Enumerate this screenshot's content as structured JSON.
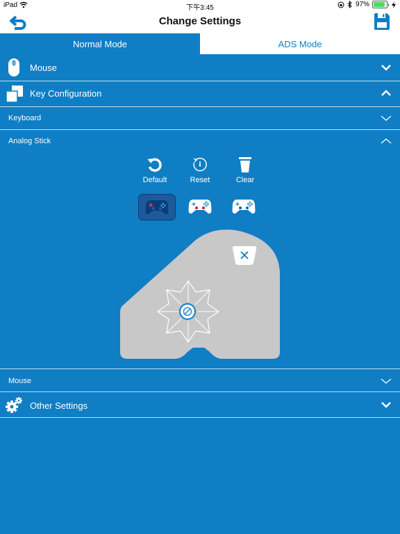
{
  "status": {
    "device": "iPad",
    "time": "下午3:45",
    "battery": "97%",
    "battery_level": 0.97
  },
  "nav": {
    "title": "Change Settings"
  },
  "tabs": [
    {
      "label": "Normal Mode",
      "active": true
    },
    {
      "label": "ADS Mode",
      "active": false
    }
  ],
  "sections": {
    "mouse": {
      "label": "Mouse",
      "icon": "mouse-icon",
      "expanded": false
    },
    "key_config": {
      "label": "Key Configuration",
      "icon": "copy-icon",
      "expanded": true
    },
    "keyboard": {
      "label": "Keyboard",
      "expanded": false
    },
    "analog_stick": {
      "label": "Analog Stick",
      "expanded": true
    },
    "sub_mouse": {
      "label": "Mouse",
      "expanded": false
    },
    "other": {
      "label": "Other Settings",
      "icon": "gear-icon",
      "expanded": false
    }
  },
  "tools": {
    "default_label": "Default",
    "reset_label": "Reset",
    "clear_label": "Clear"
  },
  "controllers": [
    {
      "icon": "gamepad-dark-icon",
      "selected": true
    },
    {
      "icon": "gamepad-white-icon",
      "selected": false
    },
    {
      "icon": "gamepad-white-blue-icon",
      "selected": false
    }
  ],
  "colors": {
    "primary": "#0f7ec4",
    "selected_controller": "#1d5a9c",
    "pad_surface": "#c8c8c8"
  }
}
